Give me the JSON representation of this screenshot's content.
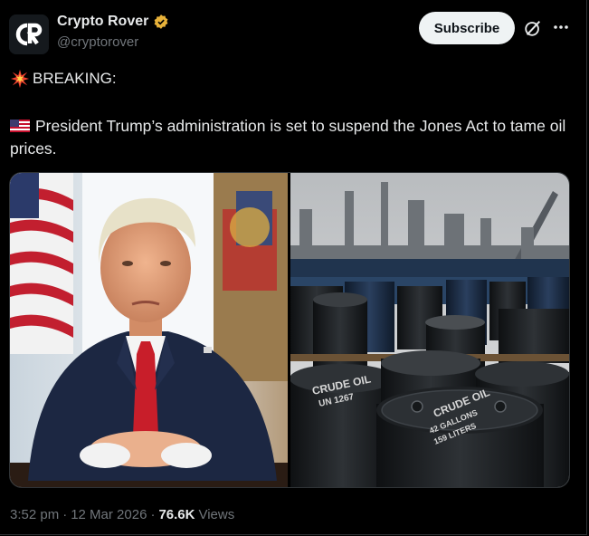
{
  "author": {
    "display_name": "Crypto Rover",
    "handle": "@cryptorover",
    "avatar_icon": "crypto-rover-logo",
    "verified_color": "#e8b23a"
  },
  "header": {
    "subscribe_label": "Subscribe",
    "grok_icon": "grok-icon",
    "more_icon": "more-icon"
  },
  "tweet": {
    "line1_icon": "collision-emoji",
    "line1_text": "BREAKING:",
    "line2_icon": "us-flag-emoji",
    "line2_text": "President Trump’s administration is set to suspend the Jones Act to tame oil prices."
  },
  "media": {
    "left_image": "photo of Trump seated with hands clasped",
    "right_image": "photo of crude oil barrels at refinery"
  },
  "footer": {
    "time": "3:52 pm",
    "separator": "·",
    "date": "12 Mar 2026",
    "separator2": "·",
    "views_count": "76.6K",
    "views_label": "Views"
  },
  "barrel_labels": [
    "CRUDE OIL",
    "UN 1267",
    "CRUDE OIL",
    "42 GALLONS",
    "159 LITERS"
  ]
}
